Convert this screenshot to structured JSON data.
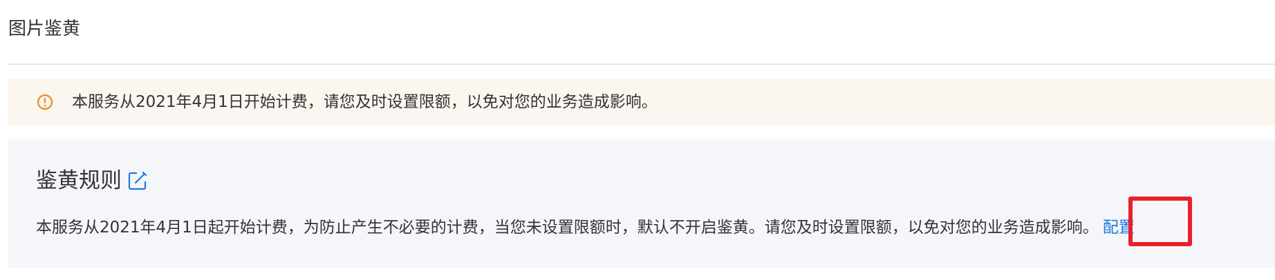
{
  "page": {
    "title": "图片鉴黄"
  },
  "notice": {
    "icon": "warning-circle-icon",
    "icon_color": "#e8912a",
    "background": "#fcf6f1",
    "text": "本服务从2021年4月1日开始计费，请您及时设置限额，以免对您的业务造成影响。"
  },
  "rules": {
    "title": "鉴黄规则",
    "edit_icon": "edit-icon",
    "description": "本服务从2021年4月1日起开始计费，为防止产生不必要的计费，当您未设置限额时，默认不开启鉴黄。请您及时设置限额，以免对您的业务造成影响。",
    "config_label": "配置",
    "link_color": "#1a7adf",
    "panel_background": "#f5f6fa"
  },
  "annotation": {
    "highlight_color": "#e8202a"
  }
}
